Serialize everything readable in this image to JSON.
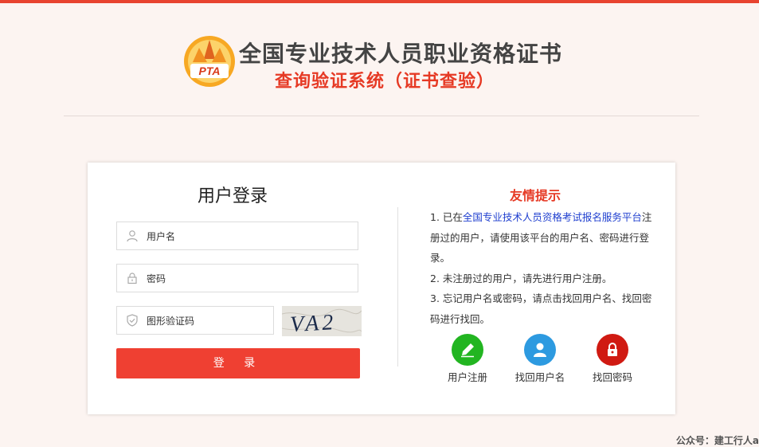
{
  "header": {
    "logo_text": "PTA",
    "title": "全国专业技术人员职业资格证书",
    "subtitle": "查询验证系统（证书查验）"
  },
  "login": {
    "title": "用户登录",
    "username_placeholder": "用户名",
    "password_placeholder": "密码",
    "captcha_placeholder": "图形验证码",
    "captcha_text": "VA2",
    "submit_label": "登 录"
  },
  "tips": {
    "title": "友情提示",
    "line1_prefix": "1. 已在",
    "line1_link": "全国专业技术人员资格考试报名服务平台",
    "line1_suffix": "注册过的用户，请使用该平台的用户名、密码进行登录。",
    "line2": "2. 未注册过的用户，请先进行用户注册。",
    "line3": "3. 忘记用户名或密码，请点击找回用户名、找回密码进行找回。"
  },
  "actions": [
    {
      "label": "用户注册",
      "icon": "pencil-icon",
      "color": "#22b521"
    },
    {
      "label": "找回用户名",
      "icon": "user-icon",
      "color": "#2d9ae0"
    },
    {
      "label": "找回密码",
      "icon": "lock-icon",
      "color": "#d01a12"
    }
  ],
  "footer": {
    "text": "公众号：建工行人a"
  },
  "colors": {
    "accent": "#e8432f",
    "button": "#ef4032",
    "link": "#1f3fcf"
  }
}
